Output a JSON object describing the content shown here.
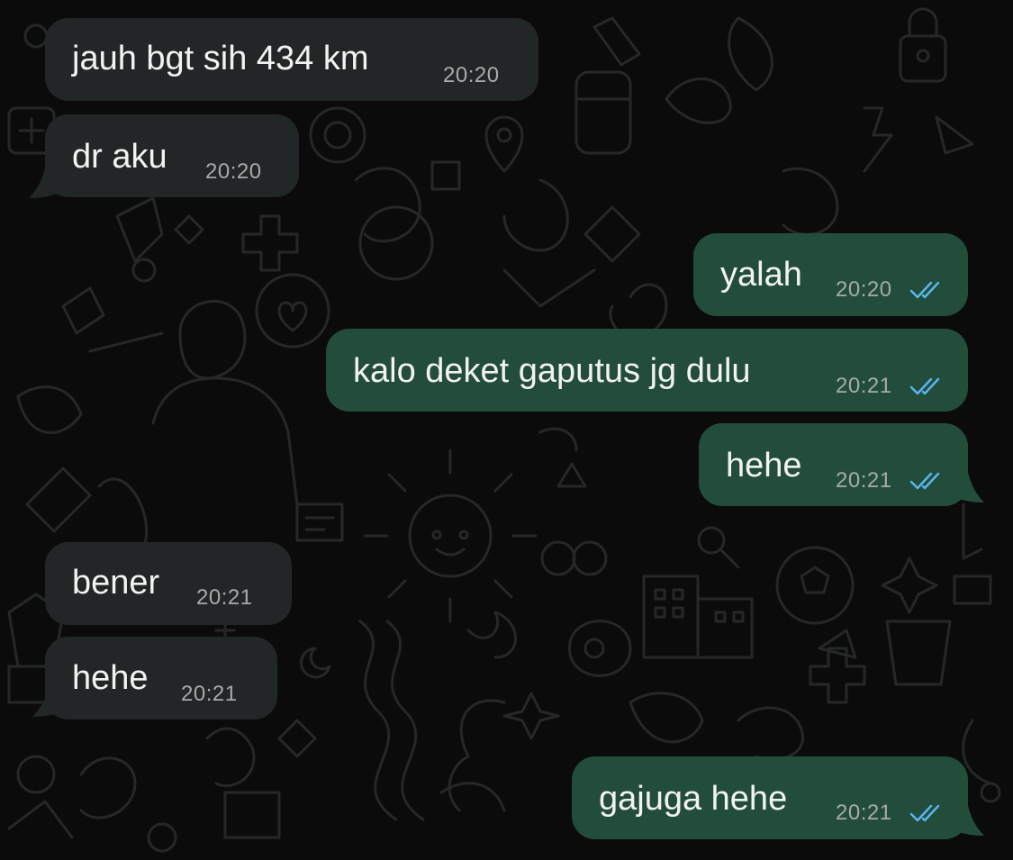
{
  "colors": {
    "background": "#0b0b0b",
    "incoming_bubble": "#232626",
    "outgoing_bubble": "#234d3b",
    "message_text": "#f2f2f2",
    "timestamp_text": "#a6aaa9",
    "read_ticks": "#5bb6f0"
  },
  "messages": [
    {
      "direction": "incoming",
      "text": "jauh bgt sih 434 km",
      "time": "20:20"
    },
    {
      "direction": "incoming",
      "text": "dr aku",
      "time": "20:20"
    },
    {
      "direction": "outgoing",
      "text": "yalah",
      "time": "20:20",
      "status": "read-double-check-icon"
    },
    {
      "direction": "outgoing",
      "text": "kalo deket gaputus jg dulu",
      "time": "20:21",
      "status": "read-double-check-icon"
    },
    {
      "direction": "outgoing",
      "text": "hehe",
      "time": "20:21",
      "status": "read-double-check-icon"
    },
    {
      "direction": "incoming",
      "text": "bener",
      "time": "20:21"
    },
    {
      "direction": "incoming",
      "text": "hehe",
      "time": "20:21"
    },
    {
      "direction": "outgoing",
      "text": "gajuga hehe",
      "time": "20:21",
      "status": "read-double-check-icon"
    }
  ]
}
